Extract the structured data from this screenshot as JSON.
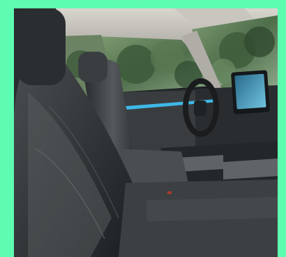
{
  "background_color": "#5efcb0",
  "photo": {
    "subject": "car-interior-front-seats",
    "palette": {
      "seat_dark": "#1f2224",
      "seat_mid": "#3a3e40",
      "seat_light": "#55595b",
      "headliner": "#b9b6b0",
      "window_green": "#5d7d58",
      "foliage_dark": "#2f4a30",
      "dashboard": "#2a2d2f",
      "ambient_light": "#3fb8e8",
      "screen": "#4aa7c9",
      "floor_light": "#6fd0f0"
    }
  }
}
